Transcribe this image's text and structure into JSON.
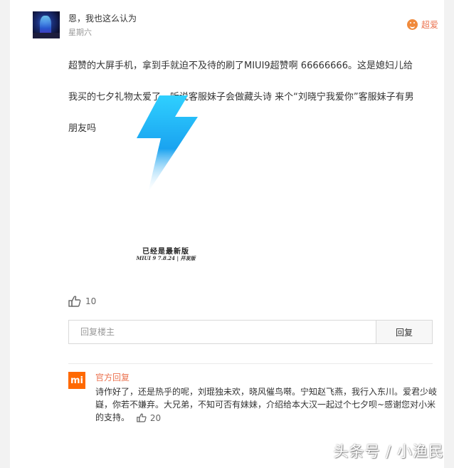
{
  "comment": {
    "username": "恩，我也这么认为",
    "time": "星期六",
    "superlike_label": "超爱",
    "text_lines": [
      "超赞的大屏手机，拿到手就迫不及待的刷了MIUI9超赞啊 66666666。这是媳妇儿给",
      "我买的七夕礼物太爱了。听说客服妹子会做藏头诗 来个“刘晓宁我爱你”客服妹子有男",
      "朋友吗"
    ],
    "image": {
      "title": "已经是最新版",
      "version": "MIUI 9 7.8.24 | 开发版"
    },
    "like_count": "10"
  },
  "reply": {
    "placeholder": "回复楼主",
    "button_label": "回复"
  },
  "official_reply": {
    "logo_text": "mi",
    "name": "官方回复",
    "text": "诗作好了，还是热乎的呢，刘琨独未欢，晓风催鸟啭。宁知赵飞燕，我行入东川。爱君少岐嶷，你若不嫌弃。大兄弟，不知可否有妹妹，介绍给本大汉一起过个七夕呗~感谢您对小米的支持。",
    "like_count": "20"
  },
  "watermark": "头条号 / 小渔民",
  "colors": {
    "accent": "#eb7350",
    "mi_orange": "#ff6900",
    "bolt_top": "#2fd0ff",
    "bolt_bottom": "#1a8fe8"
  }
}
